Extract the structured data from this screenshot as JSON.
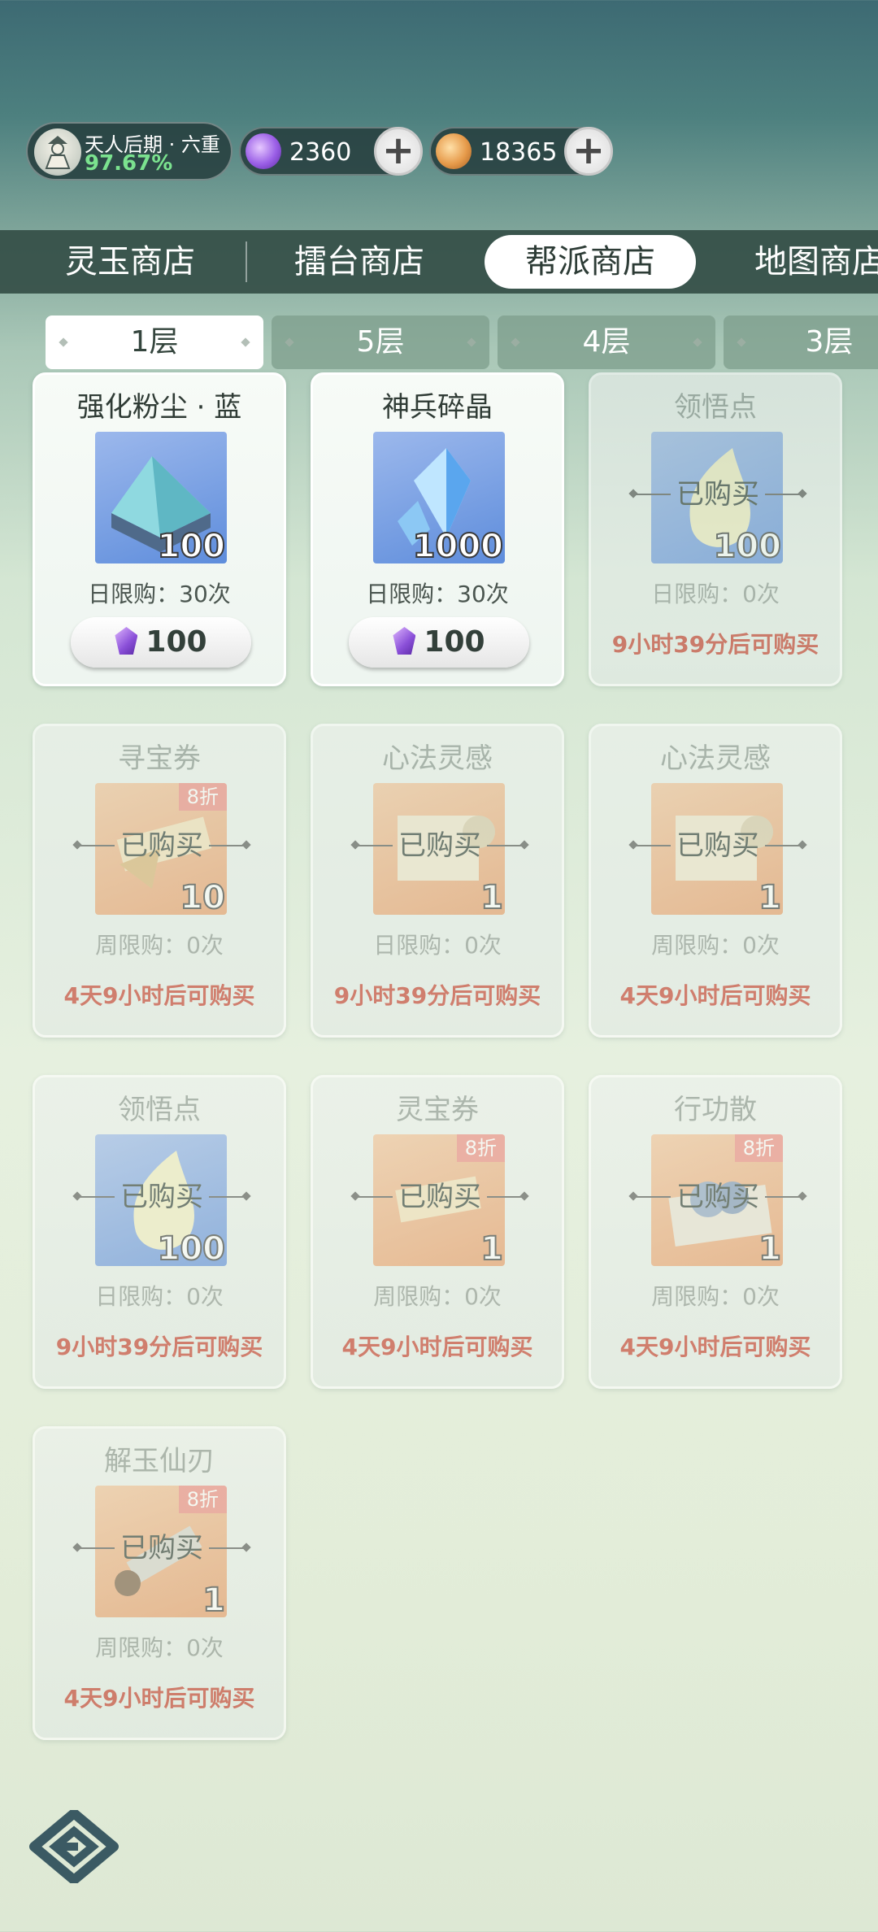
{
  "player": {
    "rank": "天人后期 · 六重",
    "progress": "97.67%"
  },
  "currencies": [
    {
      "icon": "purple-gem-icon",
      "value": "2360"
    },
    {
      "icon": "copper-coin-icon",
      "value": "18365"
    }
  ],
  "shop_tabs": [
    "灵玉商店",
    "擂台商店",
    "帮派商店",
    "地图商店"
  ],
  "active_shop_tab": "帮派商店",
  "floors": [
    "1层",
    "5层",
    "4层",
    "3层"
  ],
  "active_floor": "1层",
  "bought_label": "已购买",
  "items": [
    {
      "name": "强化粉尘 · 蓝",
      "qty": "100",
      "limit": "日限购：30次",
      "price": "100",
      "status": "available",
      "bg": "blue"
    },
    {
      "name": "神兵碎晶",
      "qty": "1000",
      "limit": "日限购：30次",
      "price": "100",
      "status": "available",
      "bg": "blue"
    },
    {
      "name": "领悟点",
      "qty": "100",
      "limit": "日限购：0次",
      "timer": "9小时39分后可购买",
      "status": "bought",
      "bg": "blue"
    },
    {
      "name": "寻宝券",
      "qty": "10",
      "discount": "8折",
      "limit": "周限购：0次",
      "timer": "4天9小时后可购买",
      "status": "bought",
      "bg": "orange"
    },
    {
      "name": "心法灵感",
      "qty": "1",
      "limit": "日限购：0次",
      "timer": "9小时39分后可购买",
      "status": "bought",
      "bg": "orange"
    },
    {
      "name": "心法灵感",
      "qty": "1",
      "limit": "周限购：0次",
      "timer": "4天9小时后可购买",
      "status": "bought",
      "bg": "orange"
    },
    {
      "name": "领悟点",
      "qty": "100",
      "limit": "日限购：0次",
      "timer": "9小时39分后可购买",
      "status": "bought",
      "bg": "blue"
    },
    {
      "name": "灵宝券",
      "qty": "1",
      "discount": "8折",
      "limit": "周限购：0次",
      "timer": "4天9小时后可购买",
      "status": "bought",
      "bg": "orange"
    },
    {
      "name": "行功散",
      "qty": "1",
      "discount": "8折",
      "limit": "周限购：0次",
      "timer": "4天9小时后可购买",
      "status": "bought",
      "bg": "orange"
    },
    {
      "name": "解玉仙刃",
      "qty": "1",
      "discount": "8折",
      "limit": "周限购：0次",
      "timer": "4天9小时后可购买",
      "status": "bought",
      "bg": "orange"
    }
  ]
}
